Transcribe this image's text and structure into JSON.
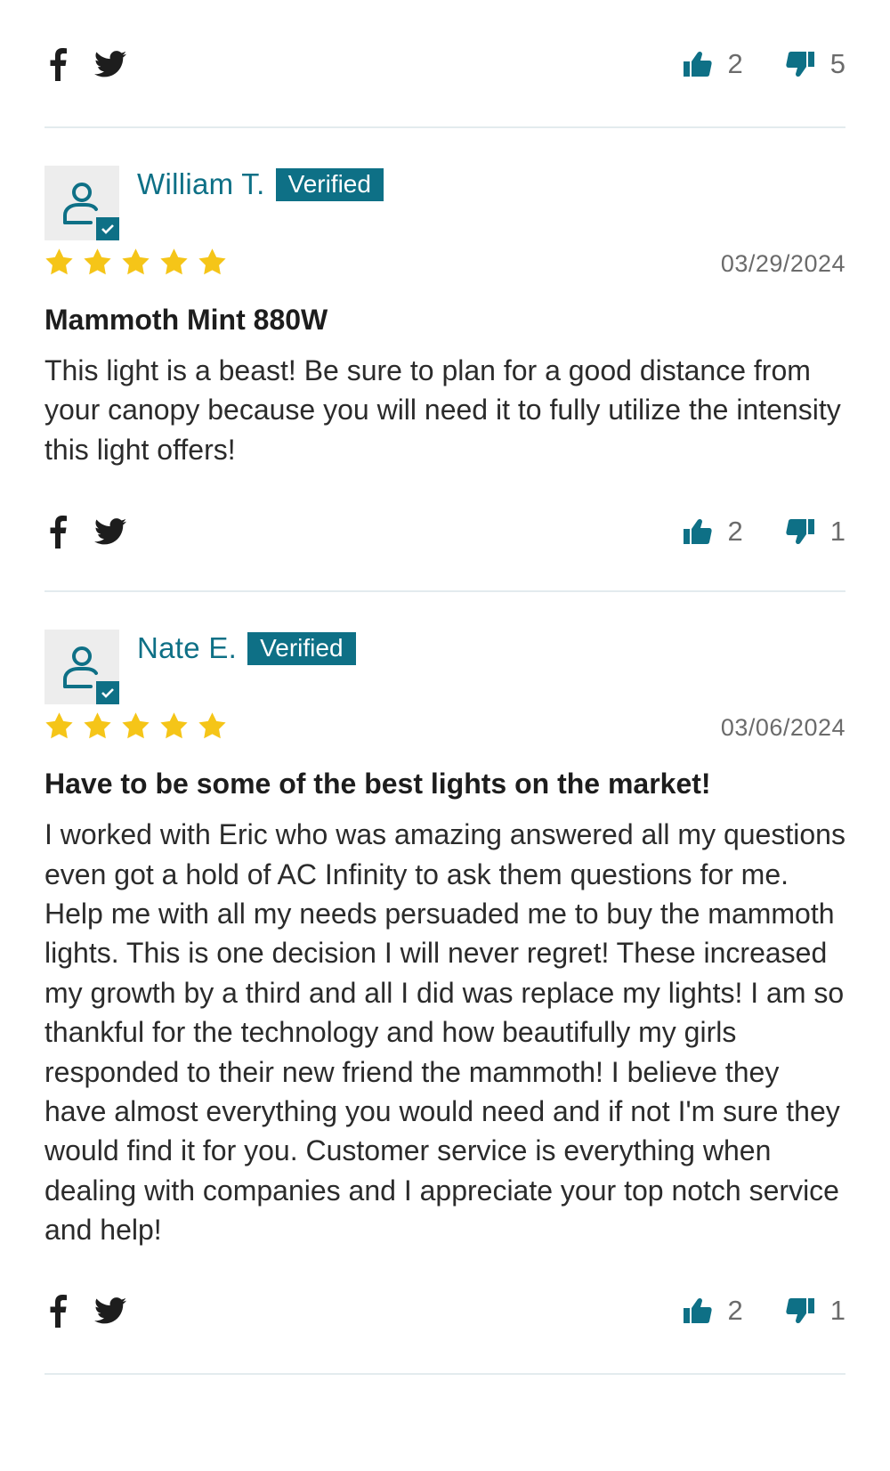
{
  "colors": {
    "accent": "#0e7086",
    "star": "#f5c518",
    "text": "#222222",
    "muted": "#6b6b6b"
  },
  "icons": {
    "facebook": "facebook-icon",
    "twitter": "twitter-icon",
    "up": "thumbs-up-icon",
    "down": "thumbs-down-icon",
    "avatar": "user-icon",
    "verified": "check-icon",
    "star": "star-icon"
  },
  "top_actions": {
    "upvotes": "2",
    "downvotes": "5"
  },
  "reviews": [
    {
      "name": "William T.",
      "badge": "Verified",
      "rating": 5,
      "date": "03/29/2024",
      "title": "Mammoth Mint 880W",
      "body": "This light is a beast! Be sure to plan for a good distance from your canopy because you will need it to fully utilize the intensity this light offers!",
      "upvotes": "2",
      "downvotes": "1"
    },
    {
      "name": "Nate E.",
      "badge": "Verified",
      "rating": 5,
      "date": "03/06/2024",
      "title": "Have to be some of the best lights on the market!",
      "body": "I worked with Eric who was amazing answered all my questions even got a hold of AC Infinity to ask them questions for me. Help me with all my needs persuaded me to buy the mammoth lights. This is one decision I will never regret! These increased my growth by a third and all I did was replace my lights! I am so thankful for the technology and how beautifully my girls responded to their new friend the mammoth! I believe they have almost everything you would need and if not I'm sure they would find it for you. Customer service is everything when dealing with companies and I appreciate your top notch service and help!",
      "upvotes": "2",
      "downvotes": "1"
    }
  ]
}
